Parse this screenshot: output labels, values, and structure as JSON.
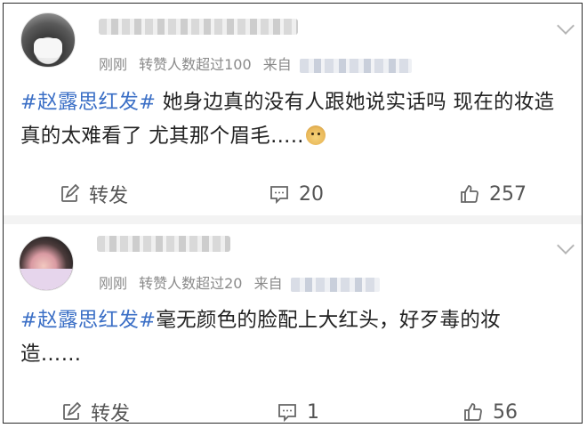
{
  "posts": [
    {
      "meta_time": "刚刚",
      "meta_likes": "转赞人数超过100",
      "meta_source_label": "来自",
      "content_tag": "#赵露思红发#",
      "content_text": " 她身边真的没有人跟她说实话吗 现在的妆造真的太难看了 尤其那个眉毛…..",
      "emoji": "doge-emoji",
      "actions": {
        "forward": "转发",
        "comments": "20",
        "likes": "257"
      }
    },
    {
      "meta_time": "刚刚",
      "meta_likes": "转赞人数超过20",
      "meta_source_label": "来自",
      "content_tag": "#赵露思红发#",
      "content_text": "毫无颜色的脸配上大红头，好歹毒的妆造……",
      "actions": {
        "forward": "转发",
        "comments": "1",
        "likes": "56"
      }
    }
  ],
  "icons": {
    "forward": "share-edit-icon",
    "comment": "comment-icon",
    "like": "thumbs-up-icon",
    "more": "chevron-down-icon"
  },
  "colors": {
    "hashtag": "#3b6fc6",
    "meta": "#8a8a8a",
    "action": "#555555"
  }
}
